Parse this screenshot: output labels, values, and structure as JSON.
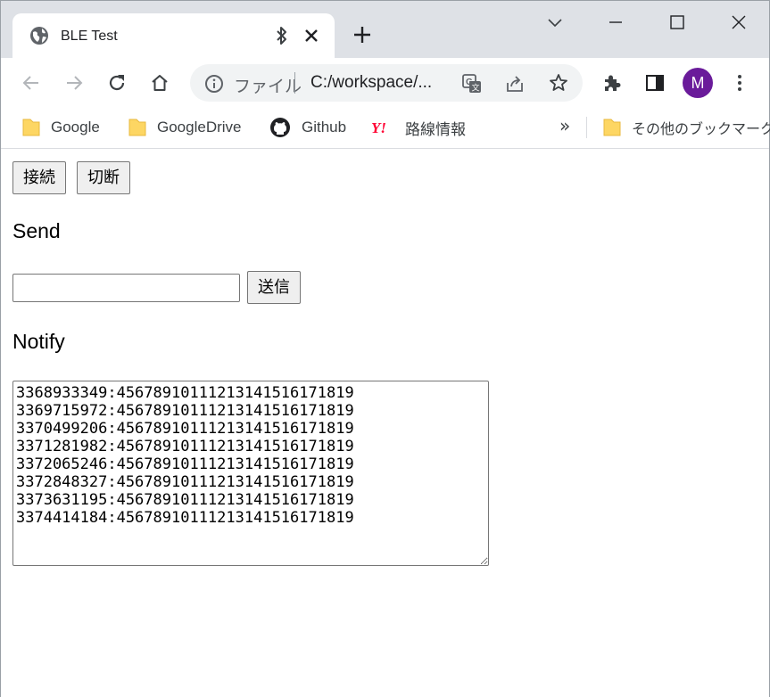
{
  "browser": {
    "tab": {
      "title": "BLE Test"
    },
    "omnibox": {
      "scheme_label": "ファイル",
      "url": "C:/workspace/..."
    },
    "avatar_letter": "M",
    "bookmarks": [
      {
        "label": "Google",
        "icon": "folder-icon"
      },
      {
        "label": "GoogleDrive",
        "icon": "folder-icon"
      },
      {
        "label": "Github",
        "icon": "github-icon"
      },
      {
        "label": "路線情報",
        "icon": "yahoo-icon"
      }
    ],
    "bookmarks_more": "»",
    "other_bookmarks": "その他のブックマーク"
  },
  "page": {
    "connect_label": "接続",
    "disconnect_label": "切断",
    "send_heading": "Send",
    "send_input_value": "",
    "send_button_label": "送信",
    "notify_heading": "Notify",
    "notify_lines": [
      "3368933349:45678910111213141516171819",
      "3369715972:45678910111213141516171819",
      "3370499206:45678910111213141516171819",
      "3371281982:45678910111213141516171819",
      "3372065246:45678910111213141516171819",
      "3372848327:45678910111213141516171819",
      "3373631195:45678910111213141516171819",
      "3374414184:45678910111213141516171819"
    ]
  },
  "colors": {
    "tabstrip": "#dee1e6",
    "avatar": "#6a1b9a",
    "folder": "#fdd663",
    "yahoo": "#ff0033"
  }
}
